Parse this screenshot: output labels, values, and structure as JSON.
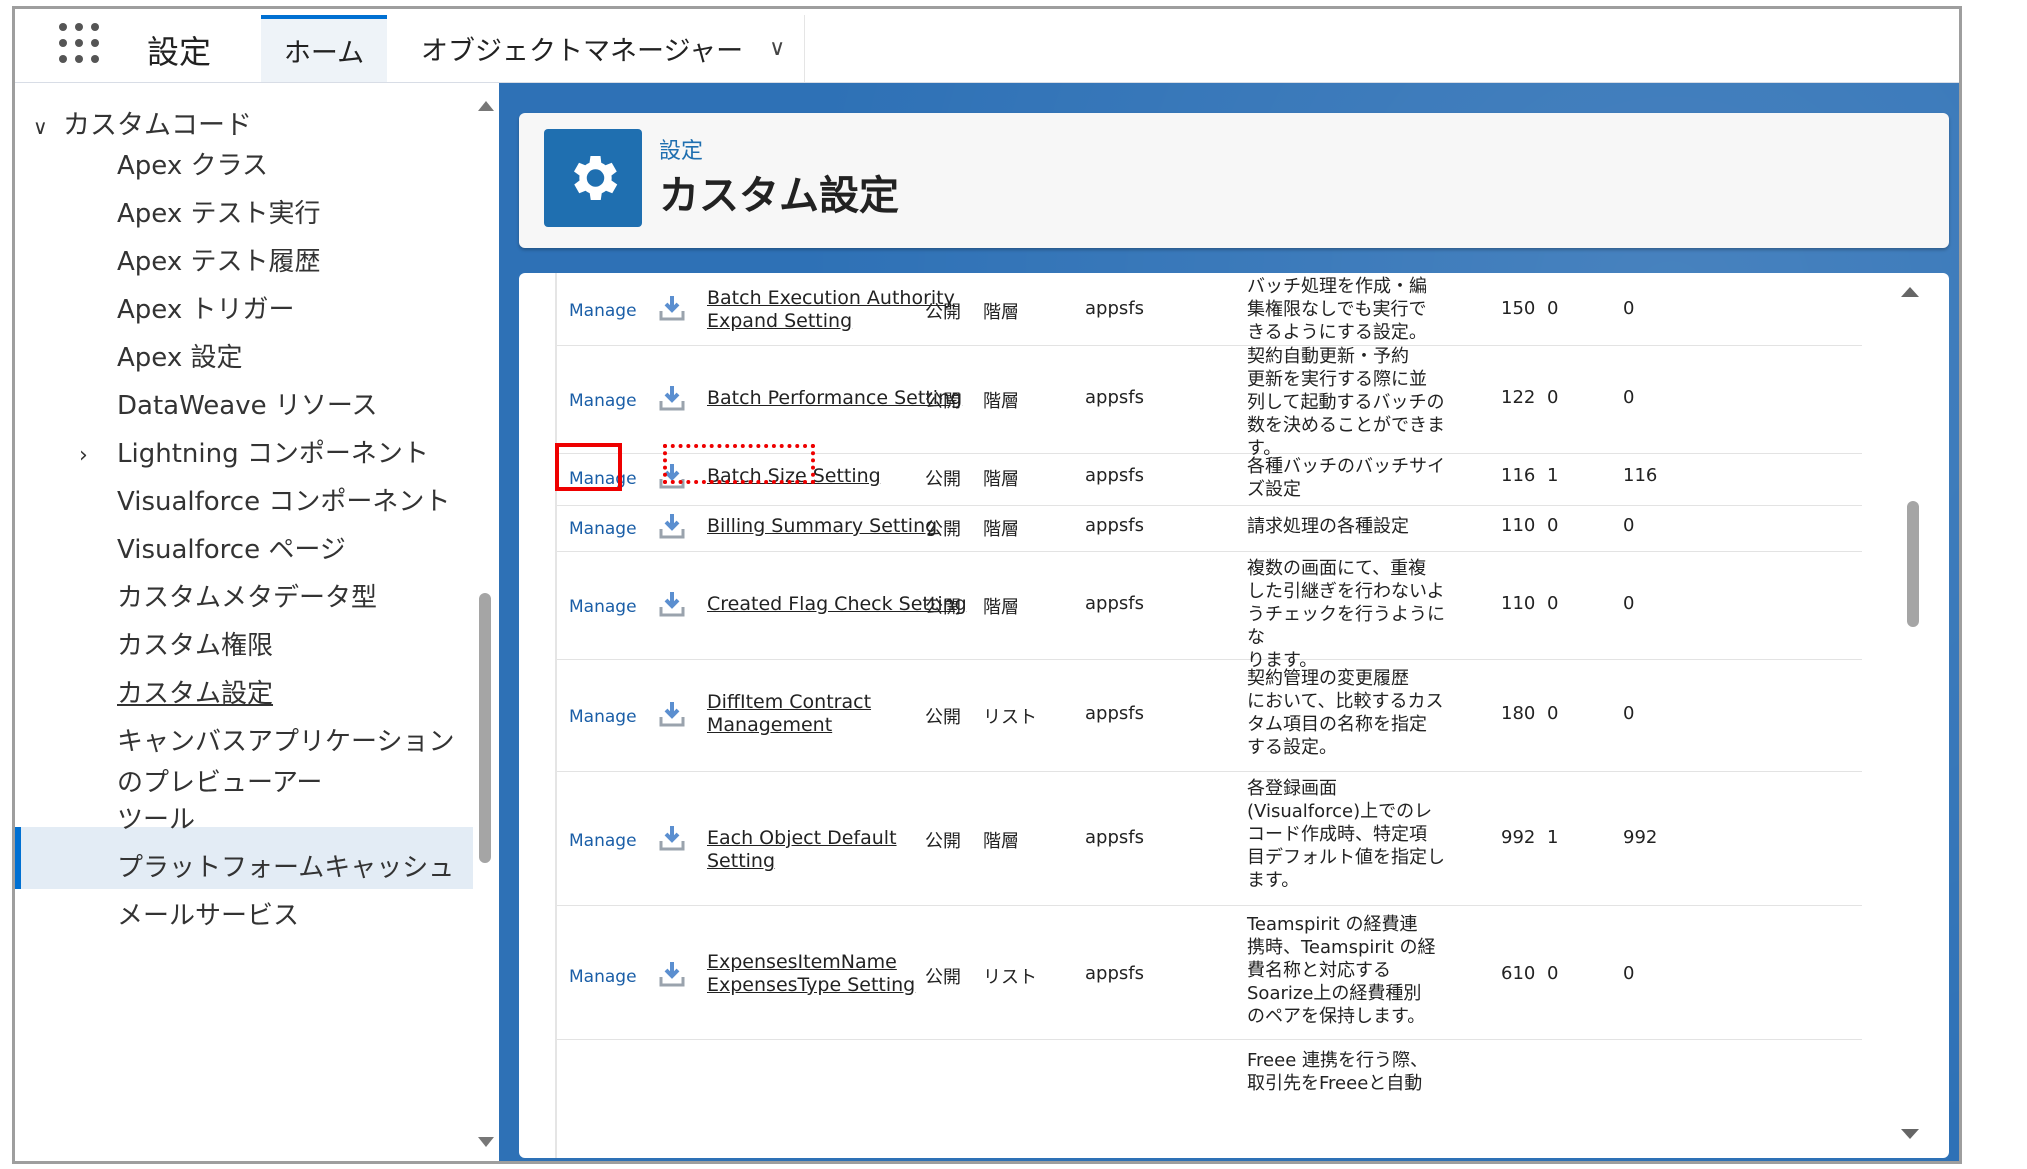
{
  "app": {
    "name": "設定"
  },
  "tabs": [
    {
      "label": "ホーム"
    },
    {
      "label": "オブジェクトマネージャー"
    }
  ],
  "sidebar": {
    "section": "カスタムコード",
    "items": [
      {
        "label": "Apex クラス"
      },
      {
        "label": "Apex テスト実行"
      },
      {
        "label": "Apex テスト履歴"
      },
      {
        "label": "Apex トリガー"
      },
      {
        "label": "Apex 設定"
      },
      {
        "label": "DataWeave リソース"
      },
      {
        "label": "Lightning コンポーネント"
      },
      {
        "label": "Visualforce コンポーネント"
      },
      {
        "label": "Visualforce ページ"
      },
      {
        "label": "カスタムメタデータ型"
      },
      {
        "label": "カスタム権限"
      },
      {
        "label": "カスタム設定"
      },
      {
        "label": "キャンバスアプリケーション"
      },
      {
        "label": "のプレビューアー"
      },
      {
        "label": "ツール"
      },
      {
        "label": "プラットフォームキャッシュ"
      },
      {
        "label": "メールサービス"
      }
    ]
  },
  "header": {
    "subtitle": "設定",
    "title": "カスタム設定",
    "icon": "gear-icon"
  },
  "rows": [
    {
      "manage": "Manage",
      "name1": "Batch Execution Authority",
      "name2": "Expand Setting",
      "visibility": "公開",
      "type": "階層",
      "namespace": "appsfs",
      "desc": [
        "バッチ処理を作成・編",
        "集権限なしでも実行で",
        "きるようにする設定。"
      ],
      "n1": "150",
      "n2": "0",
      "n3": "0"
    },
    {
      "manage": "Manage",
      "name1": "Batch Performance Setting",
      "name2": "",
      "visibility": "公開",
      "type": "階層",
      "namespace": "appsfs",
      "desc": [
        "契約自動更新・予約",
        "更新を実行する際に並",
        "列して起動するバッチの",
        "数を決めることができま",
        "す。"
      ],
      "n1": "122",
      "n2": "0",
      "n3": "0"
    },
    {
      "manage": "Manage",
      "name1": "Batch Size Setting",
      "name2": "",
      "visibility": "公開",
      "type": "階層",
      "namespace": "appsfs",
      "desc": [
        "各種バッチのバッチサイ",
        "ズ設定"
      ],
      "n1": "116",
      "n2": "1",
      "n3": "116"
    },
    {
      "manage": "Manage",
      "name1": "Billing Summary Setting",
      "name2": "",
      "visibility": "公開",
      "type": "階層",
      "namespace": "appsfs",
      "desc": [
        "請求処理の各種設定"
      ],
      "n1": "110",
      "n2": "0",
      "n3": "0"
    },
    {
      "manage": "Manage",
      "name1": "Created Flag Check Setting",
      "name2": "",
      "visibility": "公開",
      "type": "階層",
      "namespace": "appsfs",
      "desc": [
        "複数の画面にて、重複",
        "した引継ぎを行わないよ",
        "うチェックを行うようにな",
        "ります。"
      ],
      "n1": "110",
      "n2": "0",
      "n3": "0"
    },
    {
      "manage": "Manage",
      "name1": "DiffItem Contract",
      "name2": "Management",
      "visibility": "公開",
      "type": "リスト",
      "namespace": "appsfs",
      "desc": [
        "契約管理の変更履歴",
        "において、比較するカス",
        "タム項目の名称を指定",
        "する設定。"
      ],
      "n1": "180",
      "n2": "0",
      "n3": "0"
    },
    {
      "manage": "Manage",
      "name1": "Each Object Default Setting",
      "name2": "",
      "visibility": "公開",
      "type": "階層",
      "namespace": "appsfs",
      "desc": [
        "各登録画面",
        "(Visualforce)上でのレ",
        "コード作成時、特定項",
        "目デフォルト値を指定し",
        "ます。"
      ],
      "n1": "992",
      "n2": "1",
      "n3": "992"
    },
    {
      "manage": "Manage",
      "name1": "ExpensesItemName",
      "name2": "ExpensesType Setting",
      "visibility": "公開",
      "type": "リスト",
      "namespace": "appsfs",
      "desc": [
        "Teamspirit の経費連",
        "携時、Teamspirit の経",
        "費名称と対応する",
        "Soarize上の経費種別",
        "のペアを保持します。"
      ],
      "n1": "610",
      "n2": "0",
      "n3": "0"
    },
    {
      "manage": "",
      "name1": "",
      "name2": "",
      "visibility": "",
      "type": "",
      "namespace": "",
      "desc": [
        "Freee 連携を行う際、",
        "取引先をFreeeと自動"
      ],
      "n1": "",
      "n2": "",
      "n3": ""
    }
  ]
}
